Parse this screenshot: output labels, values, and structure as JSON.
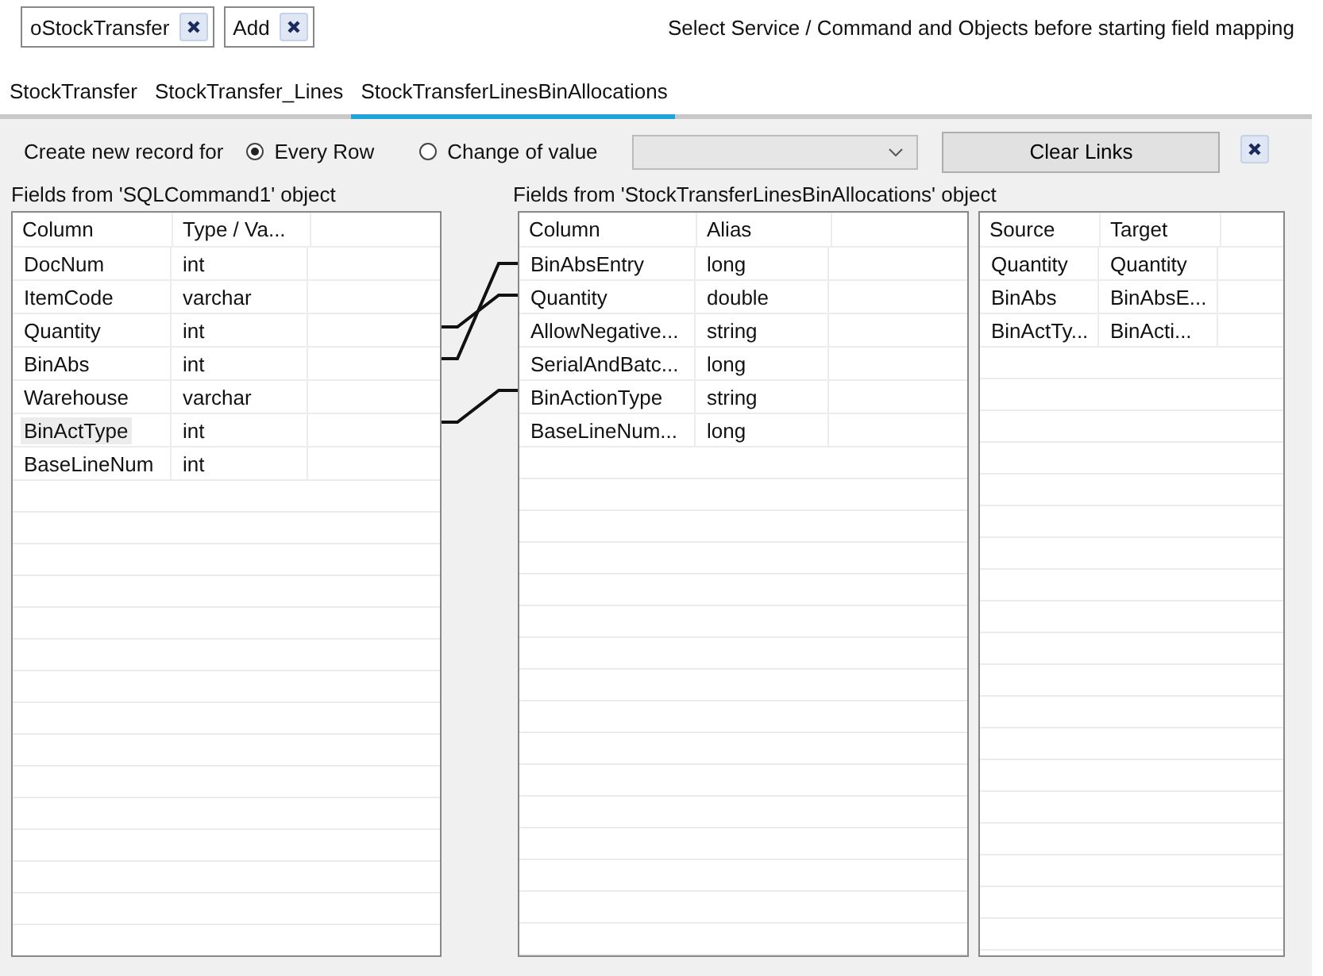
{
  "top_bar": {
    "chips": [
      {
        "label": "oStockTransfer"
      },
      {
        "label": "Add"
      }
    ],
    "hint": "Select Service / Command and Objects before starting field mapping"
  },
  "tabs": [
    {
      "label": "StockTransfer",
      "selected": false
    },
    {
      "label": "StockTransfer_Lines",
      "selected": false
    },
    {
      "label": "StockTransferLinesBinAllocations",
      "selected": true
    }
  ],
  "options": {
    "label": "Create new record for",
    "radios": [
      {
        "label": "Every Row",
        "selected": true
      },
      {
        "label": "Change of value",
        "selected": false
      }
    ],
    "dropdown": {
      "disabled": true
    },
    "clear_button": "Clear Links"
  },
  "source_table": {
    "title": "Fields from 'SQLCommand1' object",
    "columns": [
      "Column",
      "Type / Va..."
    ],
    "rows": [
      {
        "cells": [
          "DocNum",
          "int"
        ],
        "selected": false
      },
      {
        "cells": [
          "ItemCode",
          "varchar"
        ],
        "selected": false
      },
      {
        "cells": [
          "Quantity",
          "int"
        ],
        "selected": false,
        "links_to_target_rows": [
          false,
          true,
          false,
          false,
          false,
          false
        ]
      },
      {
        "cells": [
          "BinAbs",
          "int"
        ],
        "selected": false,
        "links_to_target_rows": [
          true,
          false,
          false,
          false,
          false,
          false
        ]
      },
      {
        "cells": [
          "Warehouse",
          "varchar"
        ],
        "selected": false
      },
      {
        "cells": [
          "BinActType",
          "int"
        ],
        "selected": true,
        "links_to_target_rows": [
          false,
          false,
          false,
          false,
          true,
          false
        ]
      },
      {
        "cells": [
          "BaseLineNum",
          "int"
        ],
        "selected": false
      }
    ]
  },
  "target_table": {
    "title": "Fields from 'StockTransferLinesBinAllocations' object",
    "columns": [
      "Column",
      "Alias"
    ],
    "rows": [
      [
        "BinAbsEntry",
        "long"
      ],
      [
        "Quantity",
        "double"
      ],
      [
        "AllowNegative...",
        "string"
      ],
      [
        "SerialAndBatc...",
        "long"
      ],
      [
        "BinActionType",
        "string"
      ],
      [
        "BaseLineNum...",
        "long"
      ]
    ]
  },
  "mapping_table": {
    "columns": [
      "Source",
      "Target"
    ],
    "rows": [
      [
        "Quantity",
        "Quantity"
      ],
      [
        "BinAbs",
        "BinAbsE..."
      ],
      [
        "BinActTy...",
        "BinActi..."
      ]
    ]
  }
}
